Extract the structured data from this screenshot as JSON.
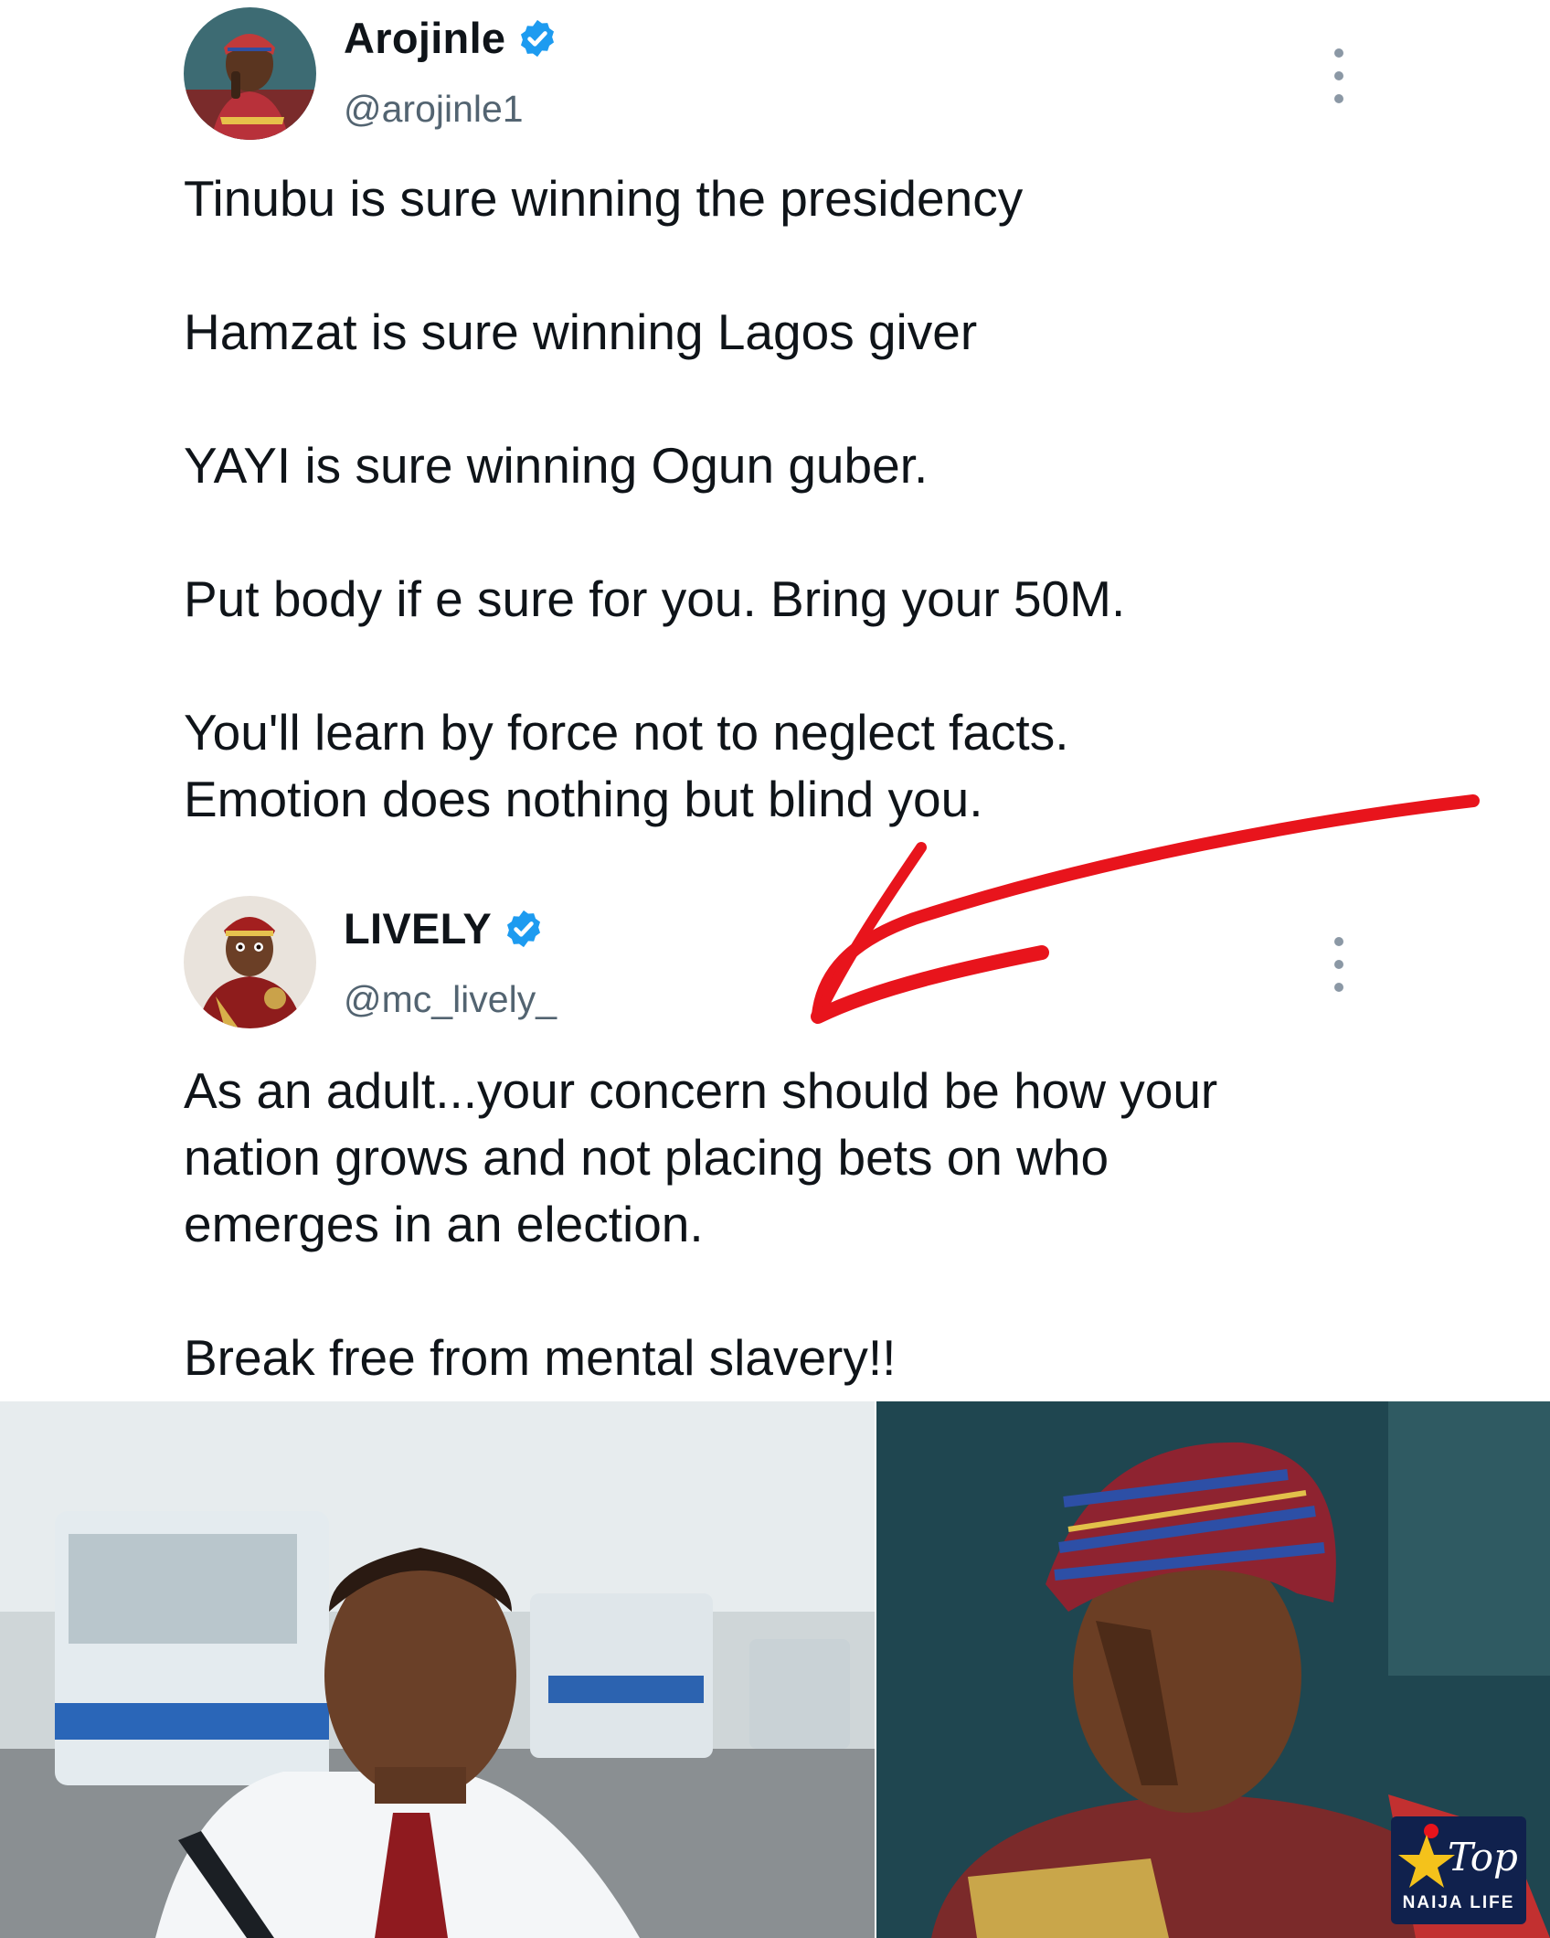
{
  "tweets": [
    {
      "name": "Arojinle",
      "handle": "@arojinle1",
      "paragraphs": [
        "Tinubu is sure winning the presidency",
        "Hamzat is sure winning Lagos giver",
        "YAYI is sure winning Ogun guber.",
        "Put body if e sure for you. Bring your 50M.",
        "You'll learn by force not to neglect facts.",
        "Emotion does nothing but blind you."
      ]
    },
    {
      "name": "LIVELY",
      "handle": "@mc_lively_",
      "paragraphs": [
        "As an adult...your concern should be how your",
        "nation grows and not placing bets on who",
        "emerges in an election.",
        "Break free from mental slavery!!"
      ]
    }
  ],
  "watermark": {
    "top": "Top",
    "sub": "NAIJA LIFE"
  },
  "colors": {
    "verified": "#1d9bf0",
    "arrow": "#e8141c",
    "logo_bg": "#10214d"
  },
  "icons": [
    "verified-badge-icon",
    "more-options-icon",
    "star-logo-icon"
  ]
}
